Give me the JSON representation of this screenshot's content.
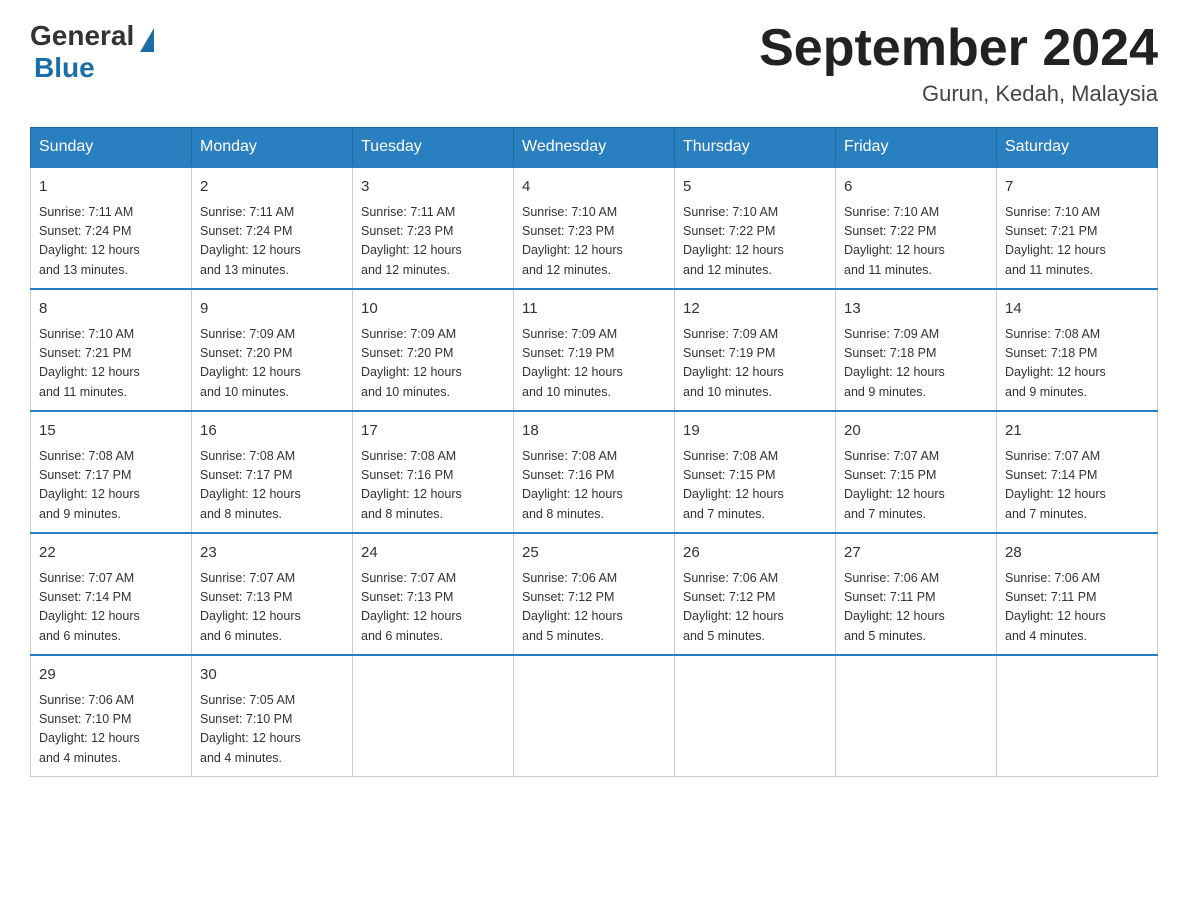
{
  "header": {
    "logo_general": "General",
    "logo_blue": "Blue",
    "title": "September 2024",
    "subtitle": "Gurun, Kedah, Malaysia"
  },
  "days_of_week": [
    "Sunday",
    "Monday",
    "Tuesday",
    "Wednesday",
    "Thursday",
    "Friday",
    "Saturday"
  ],
  "weeks": [
    [
      {
        "day": "1",
        "sunrise": "7:11 AM",
        "sunset": "7:24 PM",
        "daylight": "12 hours and 13 minutes."
      },
      {
        "day": "2",
        "sunrise": "7:11 AM",
        "sunset": "7:24 PM",
        "daylight": "12 hours and 13 minutes."
      },
      {
        "day": "3",
        "sunrise": "7:11 AM",
        "sunset": "7:23 PM",
        "daylight": "12 hours and 12 minutes."
      },
      {
        "day": "4",
        "sunrise": "7:10 AM",
        "sunset": "7:23 PM",
        "daylight": "12 hours and 12 minutes."
      },
      {
        "day": "5",
        "sunrise": "7:10 AM",
        "sunset": "7:22 PM",
        "daylight": "12 hours and 12 minutes."
      },
      {
        "day": "6",
        "sunrise": "7:10 AM",
        "sunset": "7:22 PM",
        "daylight": "12 hours and 11 minutes."
      },
      {
        "day": "7",
        "sunrise": "7:10 AM",
        "sunset": "7:21 PM",
        "daylight": "12 hours and 11 minutes."
      }
    ],
    [
      {
        "day": "8",
        "sunrise": "7:10 AM",
        "sunset": "7:21 PM",
        "daylight": "12 hours and 11 minutes."
      },
      {
        "day": "9",
        "sunrise": "7:09 AM",
        "sunset": "7:20 PM",
        "daylight": "12 hours and 10 minutes."
      },
      {
        "day": "10",
        "sunrise": "7:09 AM",
        "sunset": "7:20 PM",
        "daylight": "12 hours and 10 minutes."
      },
      {
        "day": "11",
        "sunrise": "7:09 AM",
        "sunset": "7:19 PM",
        "daylight": "12 hours and 10 minutes."
      },
      {
        "day": "12",
        "sunrise": "7:09 AM",
        "sunset": "7:19 PM",
        "daylight": "12 hours and 10 minutes."
      },
      {
        "day": "13",
        "sunrise": "7:09 AM",
        "sunset": "7:18 PM",
        "daylight": "12 hours and 9 minutes."
      },
      {
        "day": "14",
        "sunrise": "7:08 AM",
        "sunset": "7:18 PM",
        "daylight": "12 hours and 9 minutes."
      }
    ],
    [
      {
        "day": "15",
        "sunrise": "7:08 AM",
        "sunset": "7:17 PM",
        "daylight": "12 hours and 9 minutes."
      },
      {
        "day": "16",
        "sunrise": "7:08 AM",
        "sunset": "7:17 PM",
        "daylight": "12 hours and 8 minutes."
      },
      {
        "day": "17",
        "sunrise": "7:08 AM",
        "sunset": "7:16 PM",
        "daylight": "12 hours and 8 minutes."
      },
      {
        "day": "18",
        "sunrise": "7:08 AM",
        "sunset": "7:16 PM",
        "daylight": "12 hours and 8 minutes."
      },
      {
        "day": "19",
        "sunrise": "7:08 AM",
        "sunset": "7:15 PM",
        "daylight": "12 hours and 7 minutes."
      },
      {
        "day": "20",
        "sunrise": "7:07 AM",
        "sunset": "7:15 PM",
        "daylight": "12 hours and 7 minutes."
      },
      {
        "day": "21",
        "sunrise": "7:07 AM",
        "sunset": "7:14 PM",
        "daylight": "12 hours and 7 minutes."
      }
    ],
    [
      {
        "day": "22",
        "sunrise": "7:07 AM",
        "sunset": "7:14 PM",
        "daylight": "12 hours and 6 minutes."
      },
      {
        "day": "23",
        "sunrise": "7:07 AM",
        "sunset": "7:13 PM",
        "daylight": "12 hours and 6 minutes."
      },
      {
        "day": "24",
        "sunrise": "7:07 AM",
        "sunset": "7:13 PM",
        "daylight": "12 hours and 6 minutes."
      },
      {
        "day": "25",
        "sunrise": "7:06 AM",
        "sunset": "7:12 PM",
        "daylight": "12 hours and 5 minutes."
      },
      {
        "day": "26",
        "sunrise": "7:06 AM",
        "sunset": "7:12 PM",
        "daylight": "12 hours and 5 minutes."
      },
      {
        "day": "27",
        "sunrise": "7:06 AM",
        "sunset": "7:11 PM",
        "daylight": "12 hours and 5 minutes."
      },
      {
        "day": "28",
        "sunrise": "7:06 AM",
        "sunset": "7:11 PM",
        "daylight": "12 hours and 4 minutes."
      }
    ],
    [
      {
        "day": "29",
        "sunrise": "7:06 AM",
        "sunset": "7:10 PM",
        "daylight": "12 hours and 4 minutes."
      },
      {
        "day": "30",
        "sunrise": "7:05 AM",
        "sunset": "7:10 PM",
        "daylight": "12 hours and 4 minutes."
      },
      null,
      null,
      null,
      null,
      null
    ]
  ]
}
